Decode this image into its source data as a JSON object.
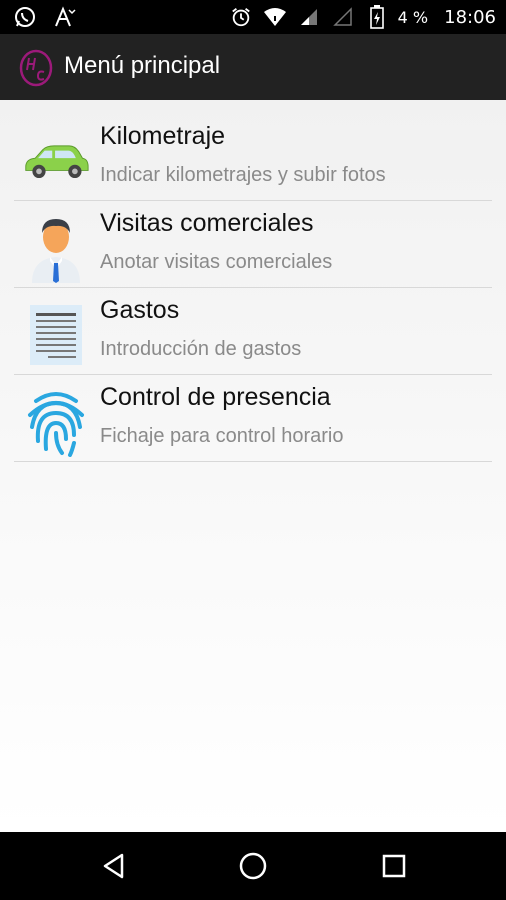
{
  "status_bar": {
    "left_icons": [
      "whatsapp-icon",
      "text-size-icon"
    ],
    "right_icons": [
      "alarm-icon",
      "wifi-icon",
      "signal-icon",
      "signal-icon",
      "battery-charging-icon"
    ],
    "battery": "4 %",
    "time": "18:06"
  },
  "app_bar": {
    "title": "Menú principal"
  },
  "menu": {
    "items": [
      {
        "title": "Kilometraje",
        "subtitle": "Indicar kilometrajes y subir fotos",
        "icon": "car-icon"
      },
      {
        "title": "Visitas comerciales",
        "subtitle": "Anotar visitas comerciales",
        "icon": "businessman-icon"
      },
      {
        "title": "Gastos",
        "subtitle": "Introducción de gastos",
        "icon": "document-icon"
      },
      {
        "title": "Control de presencia",
        "subtitle": "Fichaje para control horario",
        "icon": "fingerprint-icon"
      }
    ]
  },
  "nav_bar": {
    "buttons": [
      "back-icon",
      "home-icon",
      "recents-icon"
    ]
  }
}
